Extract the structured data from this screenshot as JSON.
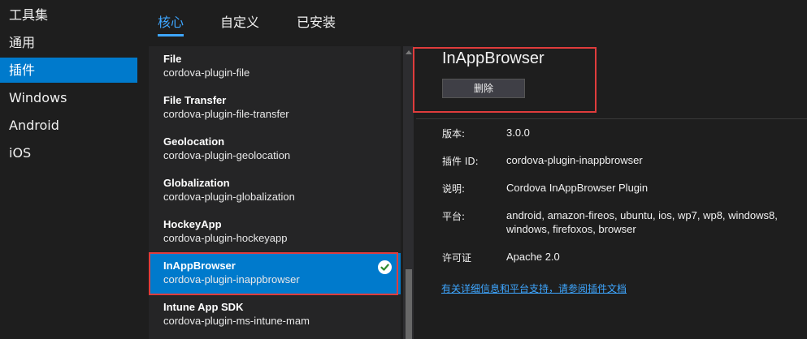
{
  "sidebar": {
    "items": [
      {
        "label": "工具集"
      },
      {
        "label": "通用"
      },
      {
        "label": "插件"
      },
      {
        "label": "Windows"
      },
      {
        "label": "Android"
      },
      {
        "label": "iOS"
      }
    ]
  },
  "tabs": [
    {
      "label": "核心"
    },
    {
      "label": "自定义"
    },
    {
      "label": "已安装"
    }
  ],
  "plugins": [
    {
      "name": "File",
      "id": "cordova-plugin-file"
    },
    {
      "name": "File Transfer",
      "id": "cordova-plugin-file-transfer"
    },
    {
      "name": "Geolocation",
      "id": "cordova-plugin-geolocation"
    },
    {
      "name": "Globalization",
      "id": "cordova-plugin-globalization"
    },
    {
      "name": "HockeyApp",
      "id": "cordova-plugin-hockeyapp"
    },
    {
      "name": "InAppBrowser",
      "id": "cordova-plugin-inappbrowser"
    },
    {
      "name": "Intune App SDK",
      "id": "cordova-plugin-ms-intune-mam"
    }
  ],
  "detail": {
    "title": "InAppBrowser",
    "delete_label": "删除",
    "props": [
      {
        "label": "版本:",
        "value": "3.0.0"
      },
      {
        "label": "插件 ID:",
        "value": "cordova-plugin-inappbrowser"
      },
      {
        "label": "说明:",
        "value": "Cordova InAppBrowser Plugin"
      },
      {
        "label": "平台:",
        "value": "android, amazon-fireos, ubuntu, ios, wp7, wp8, windows8,",
        "value2": "windows, firefoxos, browser"
      },
      {
        "label": "许可证",
        "value": "Apache 2.0"
      }
    ],
    "doc_link": "有关详细信息和平台支持，请参阅插件文档"
  },
  "colors": {
    "accent": "#007acc",
    "highlight_box": "#e03c3c",
    "link": "#3ea6ff"
  }
}
